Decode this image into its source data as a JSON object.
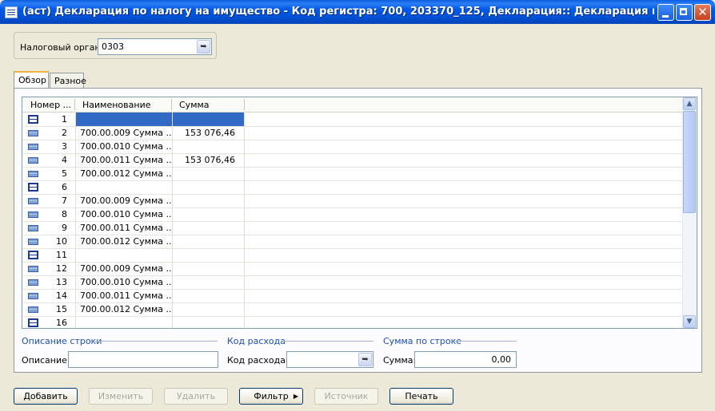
{
  "window": {
    "title": "(аст) Декларация по налогу на имущество - Код регистра: 700, 203370_125, Декларация:: Декларация по земельному ...",
    "close_glyph": "✕"
  },
  "tax_authority": {
    "label": "Налоговый орган:",
    "value": "0303"
  },
  "tabs": [
    {
      "label": "Обзор",
      "active": true
    },
    {
      "label": "Разное",
      "active": false
    }
  ],
  "grid": {
    "columns": [
      "Номер ...",
      "Наименование",
      "Сумма"
    ],
    "rows": [
      {
        "num": "1",
        "name": "",
        "sum": "",
        "type": "header",
        "selected": true
      },
      {
        "num": "2",
        "name": "700.00.009 Сумма ...",
        "sum": "153 076,46",
        "type": "detail"
      },
      {
        "num": "3",
        "name": "700.00.010 Сумма ...",
        "sum": "",
        "type": "detail"
      },
      {
        "num": "4",
        "name": "700.00.011 Сумма ...",
        "sum": "153 076,46",
        "type": "detail"
      },
      {
        "num": "5",
        "name": "700.00.012 Сумма ...",
        "sum": "",
        "type": "detail"
      },
      {
        "num": "6",
        "name": "",
        "sum": "",
        "type": "header"
      },
      {
        "num": "7",
        "name": "700.00.009 Сумма ...",
        "sum": "",
        "type": "detail"
      },
      {
        "num": "8",
        "name": "700.00.010 Сумма ...",
        "sum": "",
        "type": "detail"
      },
      {
        "num": "9",
        "name": "700.00.011 Сумма ...",
        "sum": "",
        "type": "detail"
      },
      {
        "num": "10",
        "name": "700.00.012 Сумма ...",
        "sum": "",
        "type": "detail"
      },
      {
        "num": "11",
        "name": "",
        "sum": "",
        "type": "header"
      },
      {
        "num": "12",
        "name": "700.00.009 Сумма ...",
        "sum": "",
        "type": "detail"
      },
      {
        "num": "13",
        "name": "700.00.010 Сумма ...",
        "sum": "",
        "type": "detail"
      },
      {
        "num": "14",
        "name": "700.00.011 Сумма ...",
        "sum": "",
        "type": "detail"
      },
      {
        "num": "15",
        "name": "700.00.012 Сумма ...",
        "sum": "",
        "type": "detail"
      },
      {
        "num": "16",
        "name": "",
        "sum": "",
        "type": "header"
      }
    ]
  },
  "groups": {
    "line_description": {
      "title": "Описание строки",
      "label": "Описание:",
      "value": ""
    },
    "expense_code": {
      "title": "Код расхода",
      "label": "Код расхода:",
      "value": ""
    },
    "line_sum": {
      "title": "Сумма по строке",
      "label": "Сумма:",
      "value": "0,00"
    }
  },
  "buttons": {
    "add": "Добавить",
    "edit": "Изменить",
    "delete": "Удалить",
    "filter": "Фильтр",
    "source": "Источник",
    "print": "Печать"
  },
  "icons": {
    "header_row": "section-header-icon",
    "detail_row": "detail-line-icon",
    "lookup": "lookup-arrow-icon"
  }
}
